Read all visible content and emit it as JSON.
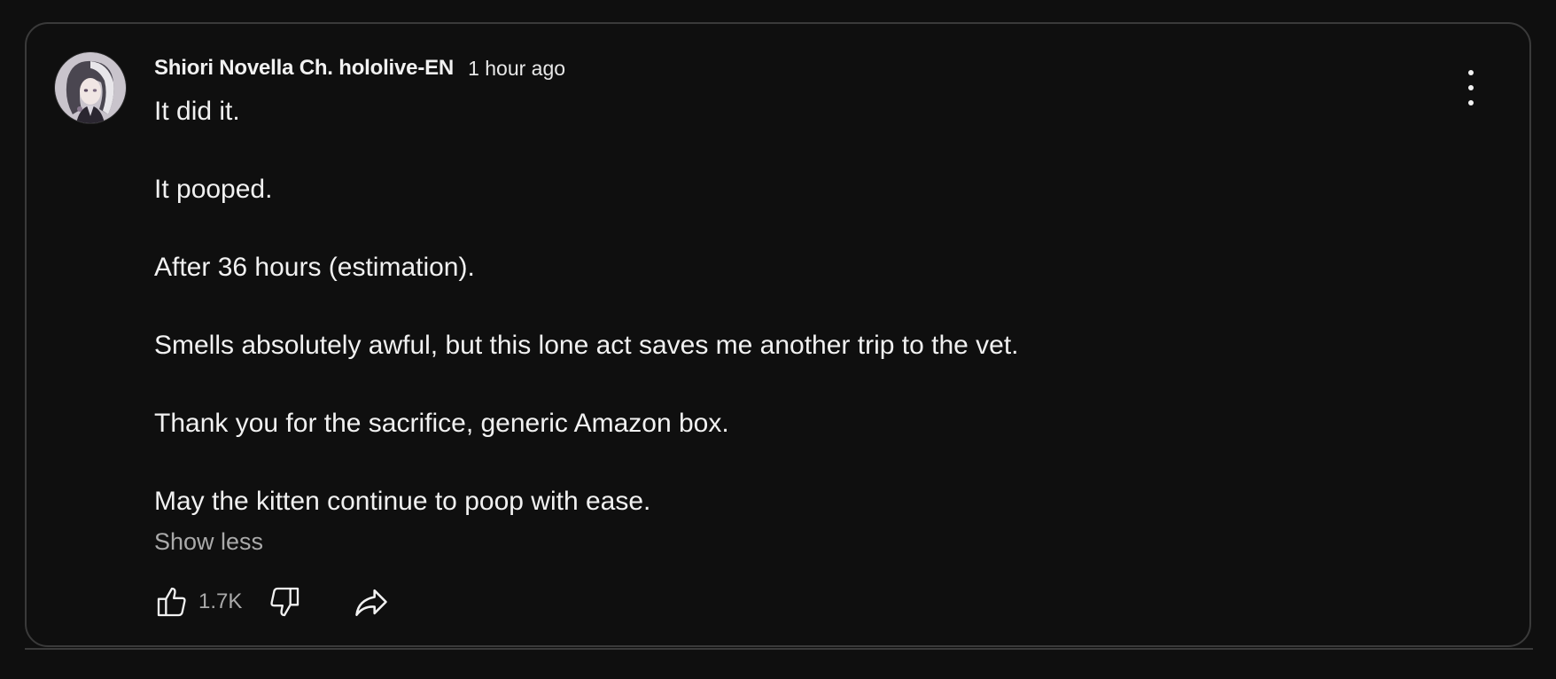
{
  "post": {
    "author": "Shiori Novella Ch. hololive-EN",
    "timestamp": "1 hour ago",
    "paragraphs": [
      "It did it.",
      "It pooped.",
      "After 36 hours (estimation).",
      "Smells absolutely awful, but this lone act saves me another trip to the vet.",
      "Thank you for the sacrifice, generic Amazon box.",
      "May the kitten continue to poop with ease."
    ],
    "show_less_label": "Show less",
    "like_count": "1.7K"
  },
  "icons": {
    "avatar": "channel-avatar",
    "menu": "more-vertical-icon",
    "like": "thumbs-up-icon",
    "dislike": "thumbs-down-icon",
    "share": "share-icon"
  },
  "colors": {
    "background": "#0f0f0f",
    "border": "#3a3a3a",
    "text_primary": "#f1f1f1",
    "text_secondary": "#aaaaaa"
  }
}
